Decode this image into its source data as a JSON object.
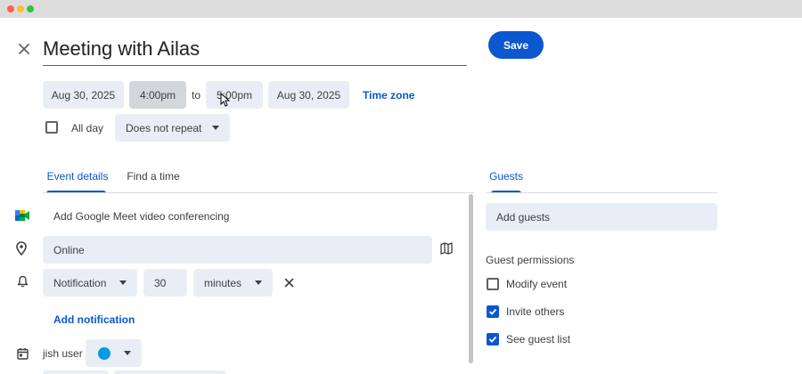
{
  "event": {
    "title": "Meeting with Ailas",
    "save_label": "Save"
  },
  "datetime": {
    "start_date": "Aug 30, 2025",
    "start_time": "4:00pm",
    "to_label": "to",
    "end_time": "5:00pm",
    "end_date": "Aug 30, 2025",
    "timezone_label": "Time zone",
    "all_day_label": "All day",
    "repeat_value": "Does not repeat"
  },
  "tabs": {
    "event_details": "Event details",
    "find_a_time": "Find a time",
    "guests": "Guests"
  },
  "details": {
    "meet_label": "Add Google Meet video conferencing",
    "location_value": "Online",
    "notification_type": "Notification",
    "notification_amount": "30",
    "notification_unit": "minutes",
    "add_notification_label": "Add notification",
    "calendar_owner": "jish user"
  },
  "guests": {
    "add_placeholder": "Add guests",
    "permissions_title": "Guest permissions",
    "permissions": [
      {
        "label": "Modify event",
        "checked": false
      },
      {
        "label": "Invite others",
        "checked": true
      },
      {
        "label": "See guest list",
        "checked": true
      }
    ]
  },
  "colors": {
    "accent": "#0b57d0",
    "field_bg": "#e9eef6",
    "calendar_color": "#039be5"
  }
}
